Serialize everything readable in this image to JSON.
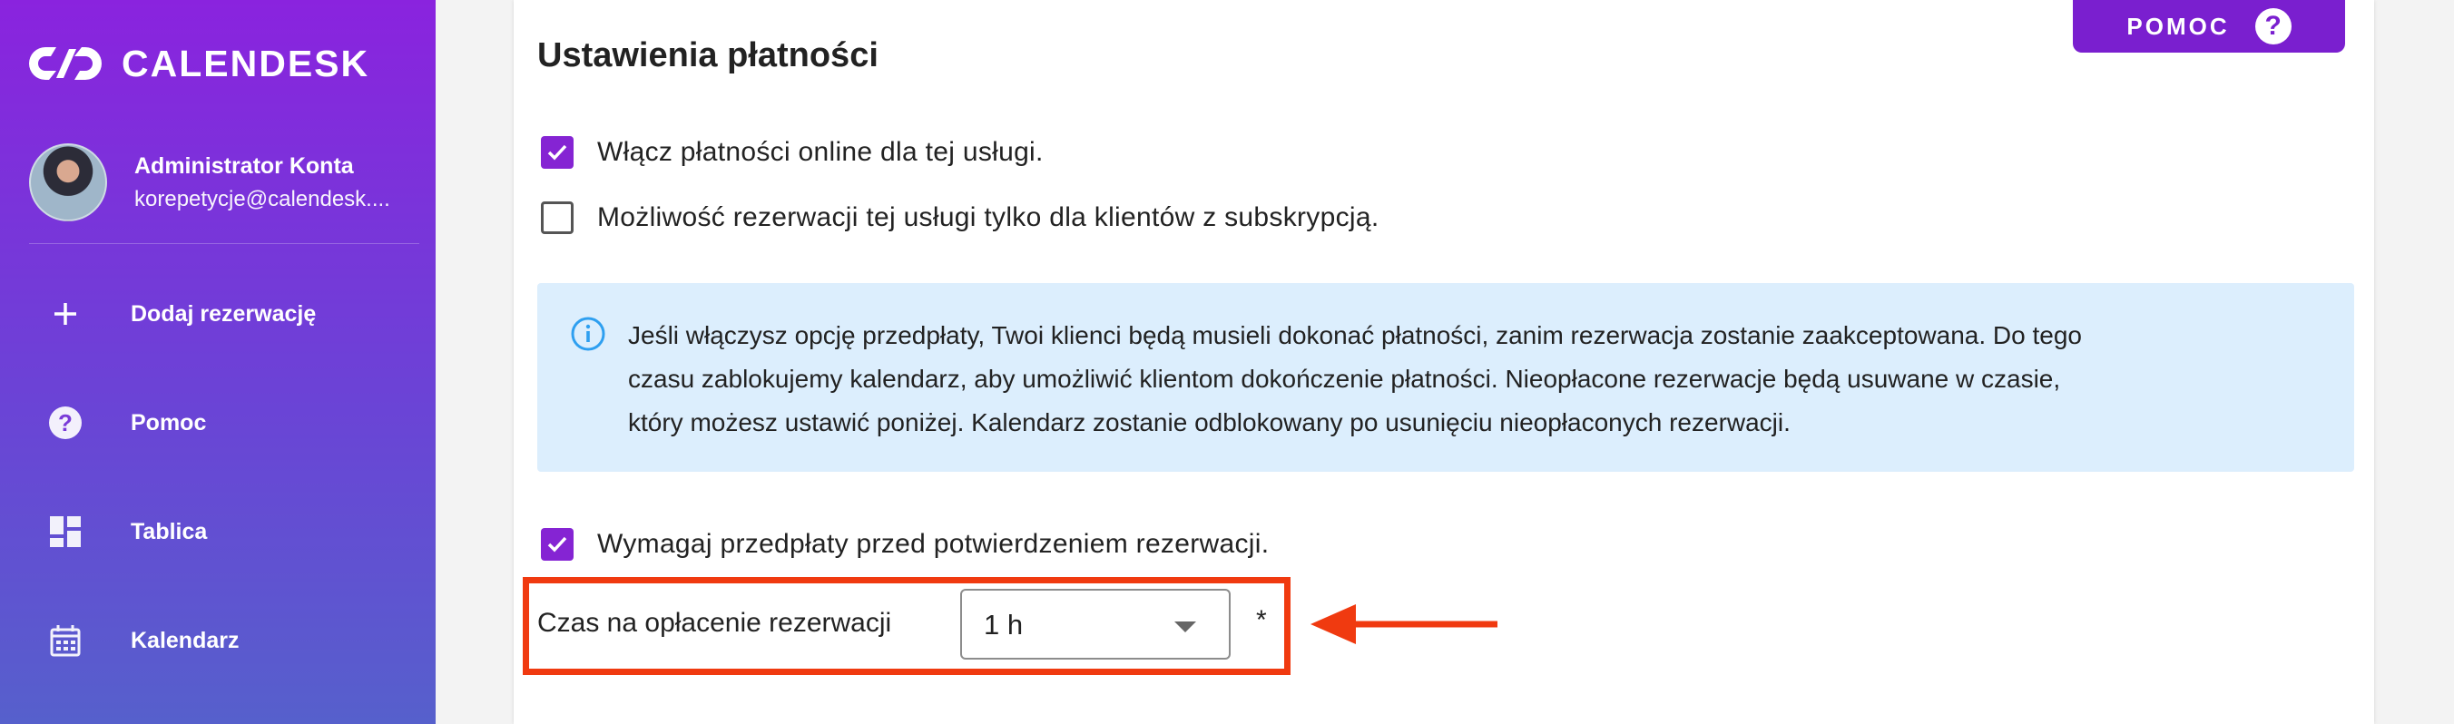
{
  "app": {
    "name": "CALENDESK"
  },
  "profile": {
    "name": "Administrator Konta",
    "email": "korepetycje@calendesk...."
  },
  "sidebar": {
    "items": [
      {
        "label": "Dodaj rezerwację",
        "icon": "plus-icon"
      },
      {
        "label": "Pomoc",
        "icon": "help-circle-icon"
      },
      {
        "label": "Tablica",
        "icon": "dashboard-icon"
      },
      {
        "label": "Kalendarz",
        "icon": "calendar-icon"
      }
    ]
  },
  "help_button": {
    "label": "POMOC",
    "icon": "help-circle-icon"
  },
  "section": {
    "title": "Ustawienia płatności",
    "options": [
      {
        "label": "Włącz płatności online dla tej usługi.",
        "checked": true
      },
      {
        "label": "Możliwość rezerwacji tej usługi tylko dla klientów z subskrypcją.",
        "checked": false
      }
    ],
    "info": {
      "icon": "info-icon",
      "line1": "Jeśli włączysz opcję przedpłaty, Twoi klienci będą musieli dokonać płatności, zanim rezerwacja zostanie zaakceptowana. Do tego",
      "line2": "czasu zablokujemy kalendarz, aby umożliwić klientom dokończenie płatności. Nieopłacone rezerwacje będą usuwane w czasie,",
      "line3": "który możesz ustawić poniżej. Kalendarz zostanie odblokowany po usunięciu nieopłaconych rezerwacji."
    },
    "prepayment": {
      "label": "Wymagaj przedpłaty przed potwierdzeniem rezerwacji.",
      "checked": true
    },
    "payment_time": {
      "label": "Czas na opłacenie rezerwacji",
      "value": "1 h",
      "required_mark": "*"
    }
  },
  "colors": {
    "accent": "#8524d3",
    "annotation": "#f03a10",
    "info_bg": "#dceefd"
  }
}
